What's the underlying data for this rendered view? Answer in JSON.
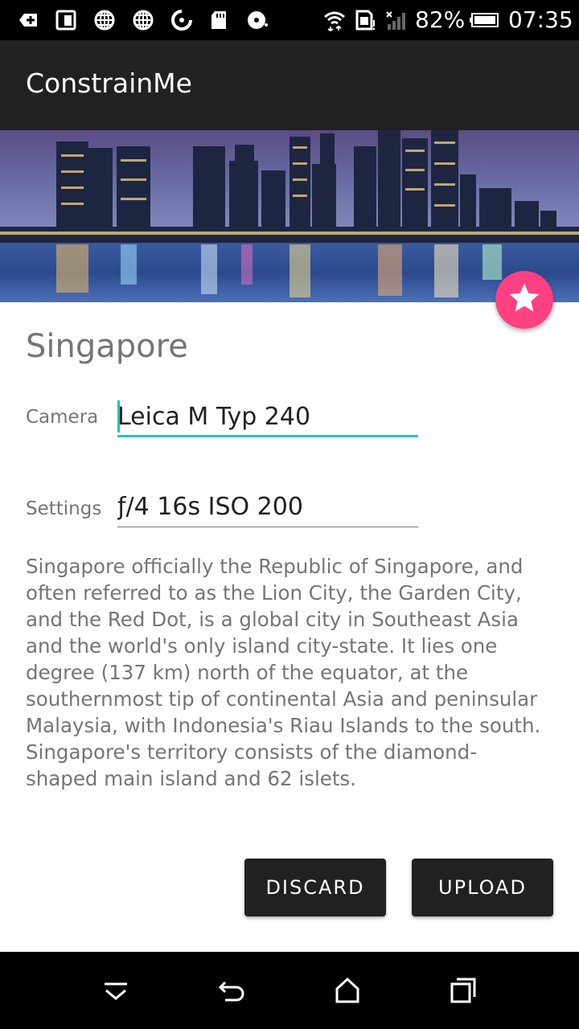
{
  "status_bar": {
    "battery_percent": "82%",
    "time": "07:35",
    "icons": [
      "add-notification-icon",
      "tablet-icon",
      "globe-icon",
      "globe-icon",
      "sync-icon",
      "sd-card-icon",
      "disc-icon",
      "wifi-icon",
      "sim-icon",
      "signal-icon",
      "battery-icon"
    ]
  },
  "app_bar": {
    "title": "ConstrainMe"
  },
  "hero": {
    "image": "singapore-skyline-image"
  },
  "fab": {
    "icon": "star-icon",
    "color": "#ff4081"
  },
  "content": {
    "title": "Singapore",
    "camera_label": "Camera",
    "camera_value": "Leica M Typ 240",
    "settings_label": "Settings",
    "settings_value": "ƒ/4 16s ISO 200",
    "description": "Singapore officially the Republic of Singapore, and often referred to as the Lion City, the Garden City, and the Red Dot, is a global city in Southeast Asia and the world's only island city-state. It lies one degree (137 km) north of the equator, at the southernmost tip of continental Asia and peninsular Malaysia, with Indonesia's Riau Islands to the south. Singapore's territory consists of the diamond-shaped main island and 62 islets."
  },
  "actions": {
    "discard_label": "DISCARD",
    "upload_label": "UPLOAD"
  },
  "nav_bar": {
    "icons": [
      "hide-keyboard-icon",
      "back-icon",
      "home-icon",
      "recents-icon"
    ]
  },
  "colors": {
    "accent": "#1cc7b3",
    "app_bar": "#212121",
    "fab": "#ff4081"
  }
}
